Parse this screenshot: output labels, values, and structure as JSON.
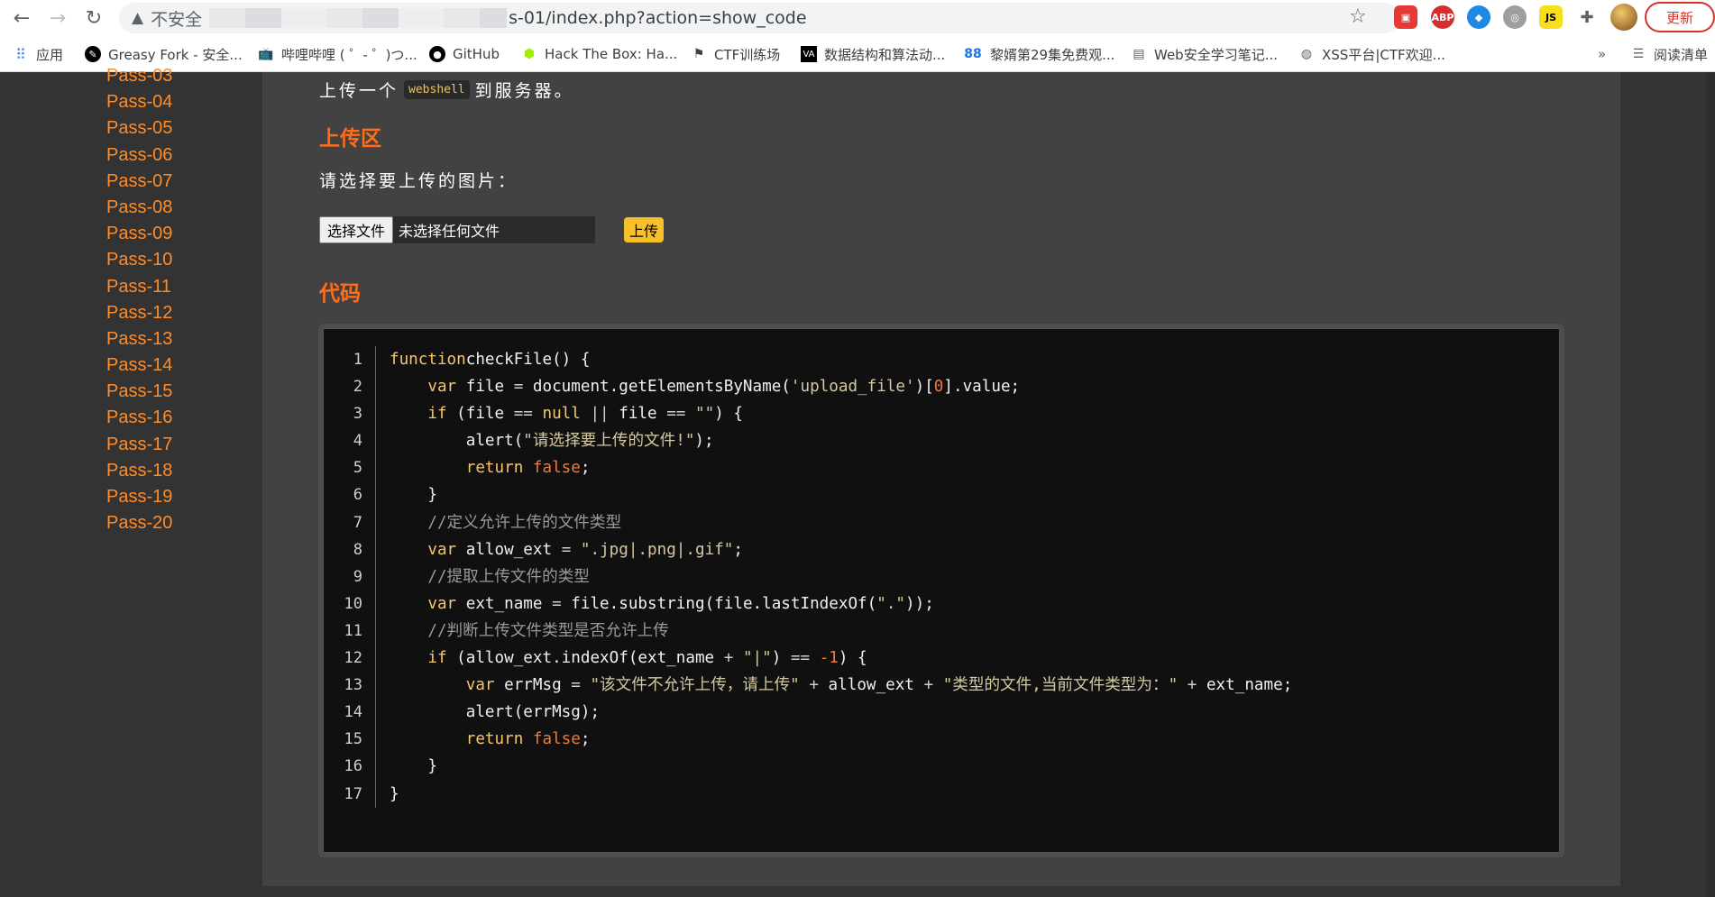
{
  "browser": {
    "insecure_label": "不安全",
    "url_visible": "s-01/index.php?action=show_code",
    "update_label": "更新",
    "extensions": [
      "ext-red",
      "abp",
      "ext-bird",
      "ext-globe",
      "js"
    ],
    "bookmarks": [
      {
        "label": "应用",
        "icon": "apps-grid-icon"
      },
      {
        "label": "Greasy Fork - 安全...",
        "icon": "greasyfork-icon"
      },
      {
        "label": "哔哩哔哩 ( ゜- ゜)つ...",
        "icon": "bilibili-icon"
      },
      {
        "label": "GitHub",
        "icon": "github-icon"
      },
      {
        "label": "Hack The Box: Ha...",
        "icon": "htb-cube-icon"
      },
      {
        "label": "CTF训练场",
        "icon": "flag-icon"
      },
      {
        "label": "数据结构和算法动...",
        "icon": "va-icon"
      },
      {
        "label": "黎婿第29集免费观...",
        "icon": "eighty-eight-icon"
      },
      {
        "label": "Web安全学习笔记...",
        "icon": "book-icon"
      },
      {
        "label": "XSS平台|CTF欢迎...",
        "icon": "globe-icon"
      }
    ],
    "bookmarks_overflow": "»",
    "reading_list": "阅读清单",
    "eighty_eight": "88"
  },
  "sidebar": {
    "items": [
      "Pass-03",
      "Pass-04",
      "Pass-05",
      "Pass-06",
      "Pass-07",
      "Pass-08",
      "Pass-09",
      "Pass-10",
      "Pass-11",
      "Pass-12",
      "Pass-13",
      "Pass-14",
      "Pass-15",
      "Pass-16",
      "Pass-17",
      "Pass-18",
      "Pass-19",
      "Pass-20"
    ]
  },
  "content": {
    "intro_before": "上传一个",
    "intro_code": "webshell",
    "intro_after": "到服务器。",
    "upload_heading": "上传区",
    "choose_label": "请选择要上传的图片：",
    "file_button": "选择文件",
    "file_none": "未选择任何文件",
    "upload_button": "上传",
    "code_heading": "代码"
  },
  "code": {
    "line_numbers": [
      "1",
      "2",
      "3",
      "4",
      "5",
      "6",
      "7",
      "8",
      "9",
      "10",
      "11",
      "12",
      "13",
      "14",
      "15",
      "16",
      "17"
    ],
    "lines": [
      [
        [
          "kw",
          "function"
        ],
        [
          "",
          "checkFile() {"
        ]
      ],
      [
        [
          "",
          "    "
        ],
        [
          "kw",
          "var"
        ],
        [
          "",
          " file "
        ],
        [
          "op",
          "="
        ],
        [
          "",
          " document.getElementsByName("
        ],
        [
          "str",
          "'upload_file'"
        ],
        [
          "",
          ")["
        ],
        [
          "lit",
          "0"
        ],
        [
          "",
          "].value;"
        ]
      ],
      [
        [
          "",
          "    "
        ],
        [
          "kw",
          "if"
        ],
        [
          "",
          " (file "
        ],
        [
          "op",
          "=="
        ],
        [
          "",
          " "
        ],
        [
          "kw",
          "null"
        ],
        [
          "",
          " "
        ],
        [
          "op",
          "||"
        ],
        [
          "",
          " file "
        ],
        [
          "op",
          "=="
        ],
        [
          "",
          " "
        ],
        [
          "str",
          "\"\""
        ],
        [
          "",
          ") {"
        ]
      ],
      [
        [
          "",
          "        alert("
        ],
        [
          "str",
          "\"请选择要上传的文件!\""
        ],
        [
          "",
          ");"
        ]
      ],
      [
        [
          "",
          "        "
        ],
        [
          "kw",
          "return"
        ],
        [
          "",
          " "
        ],
        [
          "lit",
          "false"
        ],
        [
          "",
          ";"
        ]
      ],
      [
        [
          "",
          "    }"
        ]
      ],
      [
        [
          "",
          "    "
        ],
        [
          "cm",
          "//定义允许上传的文件类型"
        ]
      ],
      [
        [
          "",
          "    "
        ],
        [
          "kw",
          "var"
        ],
        [
          "",
          " allow_ext "
        ],
        [
          "op",
          "="
        ],
        [
          "",
          " "
        ],
        [
          "str",
          "\".jpg|.png|.gif\""
        ],
        [
          "",
          ";"
        ]
      ],
      [
        [
          "",
          "    "
        ],
        [
          "cm",
          "//提取上传文件的类型"
        ]
      ],
      [
        [
          "",
          "    "
        ],
        [
          "kw",
          "var"
        ],
        [
          "",
          " ext_name "
        ],
        [
          "op",
          "="
        ],
        [
          "",
          " file.substring(file.lastIndexOf("
        ],
        [
          "str",
          "\".\""
        ],
        [
          "",
          "));"
        ]
      ],
      [
        [
          "",
          "    "
        ],
        [
          "cm",
          "//判断上传文件类型是否允许上传"
        ]
      ],
      [
        [
          "",
          "    "
        ],
        [
          "kw",
          "if"
        ],
        [
          "",
          " (allow_ext.indexOf(ext_name "
        ],
        [
          "op",
          "+"
        ],
        [
          "",
          " "
        ],
        [
          "str",
          "\"|\""
        ],
        [
          "",
          ") "
        ],
        [
          "op",
          "=="
        ],
        [
          "",
          " "
        ],
        [
          "lit",
          "-1"
        ],
        [
          "",
          ") {"
        ]
      ],
      [
        [
          "",
          "        "
        ],
        [
          "kw",
          "var"
        ],
        [
          "",
          " errMsg "
        ],
        [
          "op",
          "="
        ],
        [
          "",
          " "
        ],
        [
          "str",
          "\"该文件不允许上传，请上传\""
        ],
        [
          "",
          " "
        ],
        [
          "op",
          "+"
        ],
        [
          "",
          " allow_ext "
        ],
        [
          "op",
          "+"
        ],
        [
          "",
          " "
        ],
        [
          "str",
          "\"类型的文件,当前文件类型为：\""
        ],
        [
          "",
          " "
        ],
        [
          "op",
          "+"
        ],
        [
          "",
          " ext_name;"
        ]
      ],
      [
        [
          "",
          "        alert(errMsg);"
        ]
      ],
      [
        [
          "",
          "        "
        ],
        [
          "kw",
          "return"
        ],
        [
          "",
          " "
        ],
        [
          "lit",
          "false"
        ],
        [
          "",
          ";"
        ]
      ],
      [
        [
          "",
          "    }"
        ]
      ],
      [
        [
          "",
          "}"
        ]
      ]
    ]
  }
}
